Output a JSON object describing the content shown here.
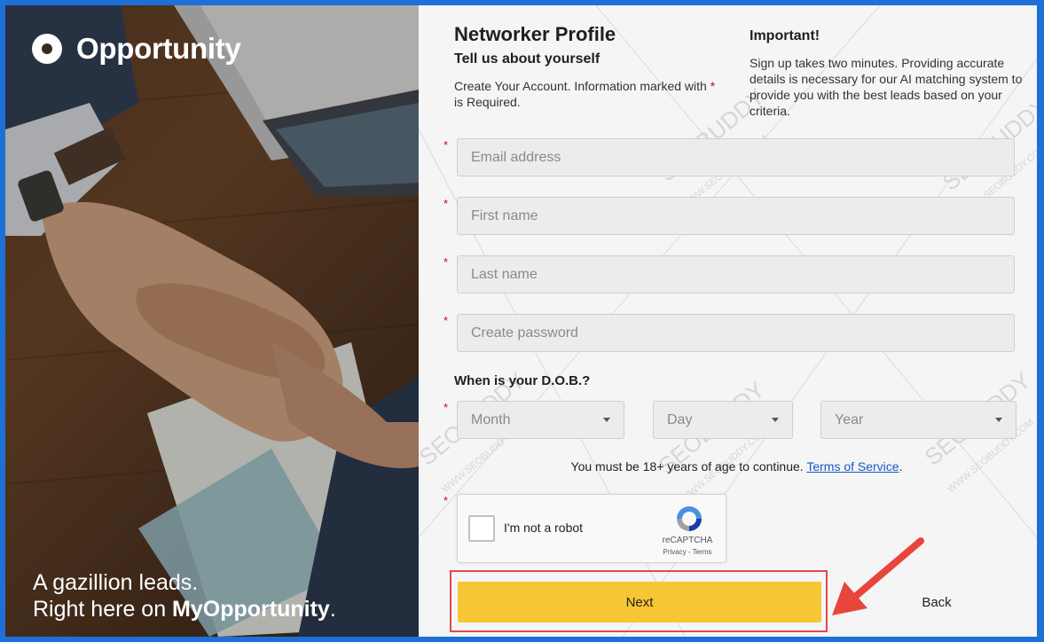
{
  "brand": {
    "name": "Opportunity"
  },
  "hero": {
    "tagline_line1": "A gazillion leads.",
    "tagline_line2_prefix": "Right here on ",
    "tagline_line2_brand": "MyOpportunity",
    "tagline_line2_suffix": "."
  },
  "form": {
    "title": "Networker Profile",
    "subtitle": "Tell us about yourself",
    "intro_before": "Create Your Account. Information marked with ",
    "intro_marker": "*",
    "intro_after": " is Required.",
    "fields": {
      "email_placeholder": "Email address",
      "first_name_placeholder": "First name",
      "last_name_placeholder": "Last name",
      "password_placeholder": "Create password"
    },
    "required_marker": "*",
    "dob": {
      "label": "When is your D.O.B.?",
      "month": "Month",
      "day": "Day",
      "year": "Year"
    },
    "age_notice": "You must be 18+ years of age to continue. ",
    "terms_link": "Terms of Service",
    "age_notice_end": ".",
    "captcha": {
      "label": "I'm not a robot",
      "brand": "reCAPTCHA",
      "links": "Privacy - Terms"
    },
    "buttons": {
      "next": "Next",
      "back": "Back"
    }
  },
  "important": {
    "title": "Important!",
    "text": "Sign up takes two minutes. Providing accurate details is necessary for our AI matching system to provide you with the best leads based on your criteria."
  },
  "watermark": {
    "text": "SEOBUDDY",
    "subtext": "WWW.SEOBUDDY.COM"
  },
  "colors": {
    "frame": "#1e6fd6",
    "accent_button": "#f6c634",
    "required": "#d0021b",
    "highlight": "#e04a4a",
    "link": "#1a57c7"
  }
}
